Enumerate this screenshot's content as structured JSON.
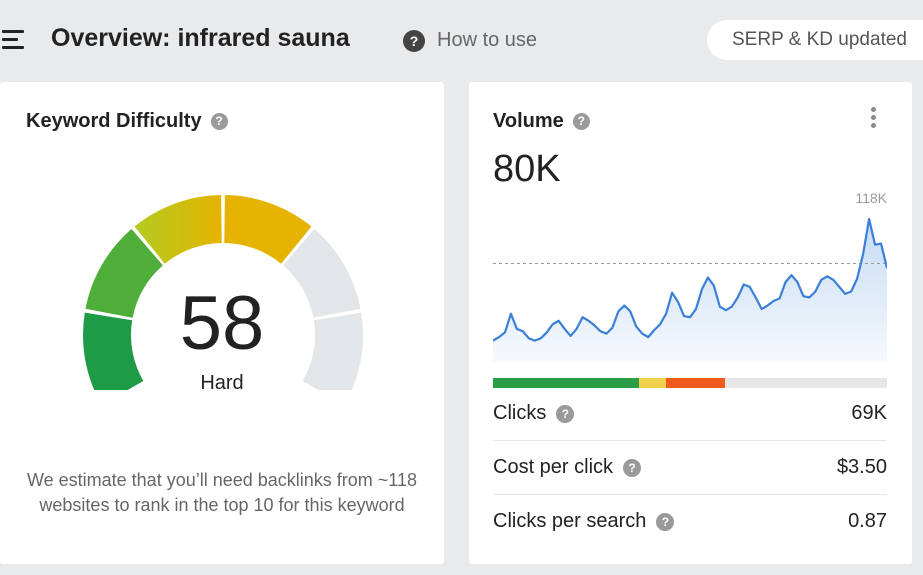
{
  "header": {
    "title": "Overview: infrared sauna",
    "how_to_use": "How to use",
    "help_glyph": "?",
    "serp_badge": "SERP & KD updated"
  },
  "keyword_difficulty": {
    "title": "Keyword Difficulty",
    "score": "58",
    "score_value": 58,
    "level": "Hard",
    "description": "We estimate that you’ll need backlinks from ~118 websites to rank in the top 10 for this keyword",
    "segment_colors": [
      "#1e9b46",
      "#4fae3a",
      "#b3cc22",
      "#e6b300",
      "#e3e6e9",
      "#e3e6e9"
    ]
  },
  "volume": {
    "title": "Volume",
    "value": "80K",
    "chart_max_label": "118K",
    "trend": [
      14,
      17,
      21,
      37,
      24,
      22,
      16,
      14,
      16,
      21,
      28,
      31,
      24,
      18,
      24,
      34,
      31,
      27,
      22,
      20,
      25,
      39,
      44,
      39,
      26,
      20,
      17,
      23,
      28,
      37,
      55,
      47,
      35,
      34,
      41,
      58,
      68,
      61,
      43,
      40,
      43,
      51,
      62,
      60,
      51,
      41,
      44,
      48,
      50,
      64,
      70,
      64,
      52,
      51,
      56,
      66,
      69,
      66,
      60,
      54,
      56,
      67,
      88,
      118,
      96,
      97,
      76
    ],
    "trend_range": [
      0,
      118
    ],
    "dashed_line_value": 80,
    "intent_bar": [
      {
        "fraction": 0.37,
        "color": "#2a9d46"
      },
      {
        "fraction": 0.07,
        "color": "#f0cf4a"
      },
      {
        "fraction": 0.15,
        "color": "#f05a1d"
      },
      {
        "fraction": 0.41,
        "color": "#e7e7e7"
      }
    ],
    "metrics": [
      {
        "label": "Clicks",
        "value": "69K"
      },
      {
        "label": "Cost per click",
        "value": "$3.50"
      },
      {
        "label": "Clicks per search",
        "value": "0.87"
      }
    ]
  }
}
